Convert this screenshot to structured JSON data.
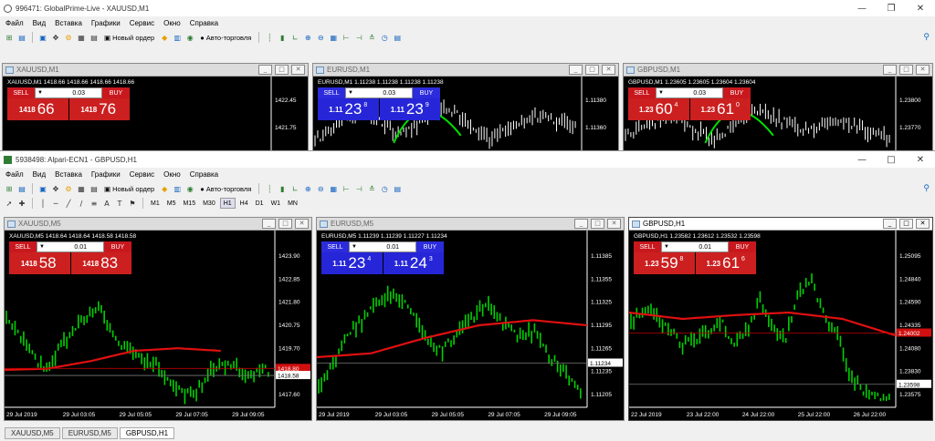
{
  "back_window": {
    "title": "996471: GlobalPrime-Live - XAUUSD,M1",
    "menu": [
      "Файл",
      "Вид",
      "Вставка",
      "Графики",
      "Сервис",
      "Окно",
      "Справка"
    ],
    "new_order": "Новый ордер",
    "autotrading": "Авто-торговля",
    "timeframes": [
      "M1",
      "M5",
      "M15",
      "M30",
      "H1",
      "H4",
      "D1",
      "W1",
      "MN"
    ],
    "charts": [
      {
        "title": "XAUUSD,M1",
        "info": "XAUUSD,M1  1418.66 1418.66 1418.66 1418.66",
        "sell": "SELL",
        "buy": "BUY",
        "lot": "0.03",
        "bid_small": "1418",
        "bid_big": "66",
        "bid_sup": "",
        "ask_small": "1418",
        "ask_big": "76",
        "ask_sup": "",
        "scheme": "red",
        "ticks": [
          "1422.45",
          "1421.75"
        ]
      },
      {
        "title": "EURUSD,M1",
        "info": "EURUSD,M1  1.11238 1.11238 1.11238 1.11238",
        "sell": "SELL",
        "buy": "BUY",
        "lot": "0.03",
        "bid_small": "1.11",
        "bid_big": "23",
        "bid_sup": "8",
        "ask_small": "1.11",
        "ask_big": "23",
        "ask_sup": "9",
        "scheme": "blue",
        "ticks": [
          "1.11380",
          "1.11360"
        ]
      },
      {
        "title": "GBPUSD,M1",
        "info": "GBPUSD,M1  1.23605 1.23605 1.23604 1.23604",
        "sell": "SELL",
        "buy": "BUY",
        "lot": "0.03",
        "bid_small": "1.23",
        "bid_big": "60",
        "bid_sup": "4",
        "ask_small": "1.23",
        "ask_big": "61",
        "ask_sup": "0",
        "scheme": "red",
        "ticks": [
          "1.23800",
          "1.23770"
        ]
      }
    ]
  },
  "front_window": {
    "title": "5938498: Alpari-ECN1 - GBPUSD,H1",
    "menu": [
      "Файл",
      "Вид",
      "Вставка",
      "Графики",
      "Сервис",
      "Окно",
      "Справка"
    ],
    "new_order": "Новый ордер",
    "autotrading": "Авто-торговля",
    "timeframes": [
      "M1",
      "M5",
      "M15",
      "M30",
      "H1",
      "H4",
      "D1",
      "W1",
      "MN"
    ],
    "active_timeframe": "H1",
    "charts": [
      {
        "title": "XAUUSD,M5",
        "info": "XAUUSD,M5  1418.64 1418.64 1418.58 1418.58",
        "sell": "SELL",
        "buy": "BUY",
        "lot": "0.01",
        "bid_small": "1418",
        "bid_big": "58",
        "bid_sup": "",
        "ask_small": "1418",
        "ask_big": "83",
        "ask_sup": "",
        "scheme": "red",
        "ticks": [
          "1423.90",
          "1422.85",
          "1421.80",
          "1420.75",
          "1419.70",
          "1418.65",
          "1417.60"
        ],
        "price_labels": [
          "1418.80",
          "1418.58"
        ],
        "times": [
          "29 Jul 2019",
          "29 Jul 03:05",
          "29 Jul 05:05",
          "29 Jul 07:05",
          "29 Jul 09:05"
        ]
      },
      {
        "title": "EURUSD,M5",
        "info": "EURUSD,M5  1.11239 1.11239 1.11227 1.11234",
        "sell": "SELL",
        "buy": "BUY",
        "lot": "0.01",
        "bid_small": "1.11",
        "bid_big": "23",
        "bid_sup": "4",
        "ask_small": "1.11",
        "ask_big": "24",
        "ask_sup": "3",
        "scheme": "blue",
        "ticks": [
          "1.11385",
          "1.11355",
          "1.11325",
          "1.11295",
          "1.11265",
          "1.11235",
          "1.11205"
        ],
        "price_labels": [
          "1.11234"
        ],
        "times": [
          "29 Jul 2019",
          "29 Jul 03:05",
          "29 Jul 05:05",
          "29 Jul 07:05",
          "29 Jul 09:05"
        ]
      },
      {
        "title": "GBPUSD,H1",
        "info": "GBPUSD,H1  1.23582 1.23612 1.23532 1.23598",
        "sell": "SELL",
        "buy": "BUY",
        "lot": "0.01",
        "bid_small": "1.23",
        "bid_big": "59",
        "bid_sup": "8",
        "ask_small": "1.23",
        "ask_big": "61",
        "ask_sup": "6",
        "scheme": "red",
        "ticks": [
          "1.25095",
          "1.24840",
          "1.24590",
          "1.24335",
          "1.24080",
          "1.23830",
          "1.23575"
        ],
        "price_labels": [
          "1.24002",
          "1.23598"
        ],
        "times": [
          "22 Jul 2019",
          "23 Jul 22:00",
          "24 Jul 22:00",
          "25 Jul 22:00",
          "26 Jul 22:00"
        ]
      }
    ]
  },
  "tabs": [
    "XAUUSD,M5",
    "EURUSD,M5",
    "GBPUSD,H1"
  ],
  "active_tab": "GBPUSD,H1",
  "colors": {
    "candle": "#00e000",
    "ma": "#e01010",
    "sell_red": "#cc1f1f",
    "sell_blue": "#2626d8"
  }
}
